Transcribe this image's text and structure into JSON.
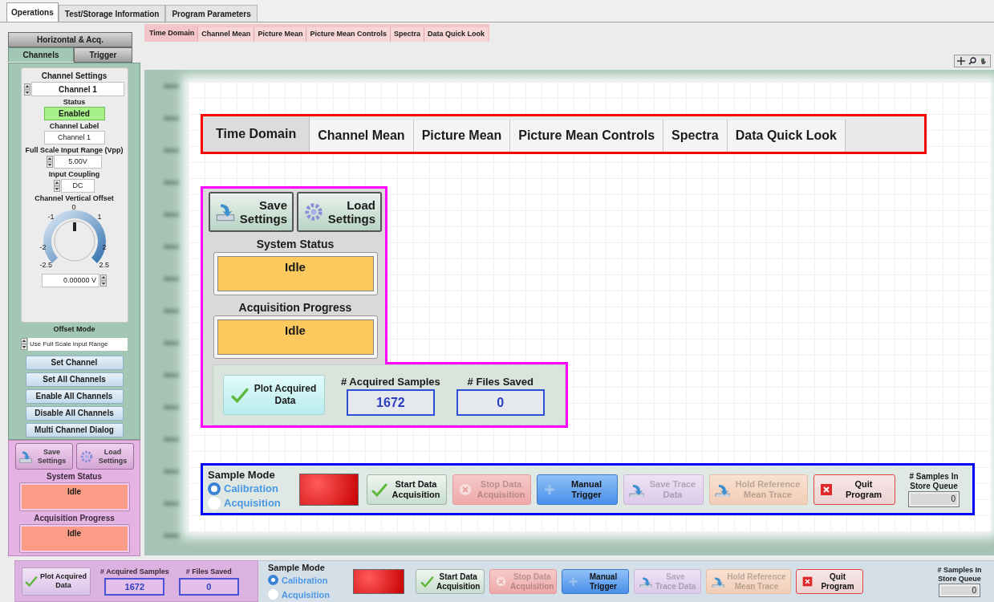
{
  "main_tabs": [
    {
      "label": "Operations",
      "selected": true
    },
    {
      "label": "Test/Storage Information",
      "selected": false
    },
    {
      "label": "Program Parameters",
      "selected": false
    }
  ],
  "side_tabs_upper": [
    {
      "label": "Horizontal & Acq.",
      "selected": false
    }
  ],
  "side_tabs_lower": [
    {
      "label": "Channels",
      "selected": true
    },
    {
      "label": "Trigger",
      "selected": false
    }
  ],
  "channel_settings": {
    "title": "Channel Settings",
    "channel": "Channel 1",
    "status_caption": "Status",
    "status": "Enabled",
    "enabled": true,
    "label_caption": "Channel Label",
    "label_value": "Channel 1",
    "range_caption": "Full Scale Input Range (Vpp)",
    "range_value": "5.00V",
    "coupling_caption": "Input Coupling",
    "coupling_value": "DC",
    "offset_caption": "Channel Vertical Offset",
    "dial": {
      "labels": [
        "0",
        "-1",
        "1",
        "-2",
        "2",
        "-2.5",
        "2.5"
      ]
    },
    "offset_value": "0.00000 V"
  },
  "offset_mode": {
    "caption": "Offset Mode",
    "value": "Use Full Scale Input Range"
  },
  "channel_buttons": [
    "Set Channel",
    "Set All Channels",
    "Enable All Channels",
    "Disable All Channels",
    "Multi Channel Dialog"
  ],
  "side_status": {
    "buttons": [
      {
        "kind": "save",
        "label": "Save Settings"
      },
      {
        "kind": "load",
        "label": "Load Settings"
      }
    ],
    "fields": [
      {
        "caption": "System Status",
        "value": "Idle"
      },
      {
        "caption": "Acquisition Progress",
        "value": "Idle"
      }
    ]
  },
  "sub_tabs": [
    {
      "label": "Time Domain",
      "selected": true
    },
    {
      "label": "Channel Mean",
      "selected": false
    },
    {
      "label": "Picture Mean",
      "selected": false
    },
    {
      "label": "Picture Mean Controls",
      "selected": false
    },
    {
      "label": "Spectra",
      "selected": false
    },
    {
      "label": "Data Quick Look",
      "selected": false
    }
  ],
  "callout": {
    "tabs": [
      {
        "label": "Time Domain",
        "selected": true
      },
      {
        "label": "Channel Mean",
        "selected": false
      },
      {
        "label": "Picture Mean",
        "selected": false
      },
      {
        "label": "Picture Mean Controls",
        "selected": false
      },
      {
        "label": "Spectra",
        "selected": false
      },
      {
        "label": "Data Quick Look",
        "selected": false
      }
    ],
    "status": {
      "buttons": [
        {
          "kind": "save",
          "label": "Save Settings"
        },
        {
          "kind": "load",
          "label": "Load Settings"
        }
      ],
      "fields": [
        {
          "caption": "System Status",
          "value": "Idle"
        },
        {
          "caption": "Acquisition Progress",
          "value": "Idle"
        }
      ]
    },
    "counters": {
      "plot_button": "Plot Acquired Data",
      "samples_caption": "# Acquired Samples",
      "samples": "1672",
      "files_caption": "# Files Saved",
      "files": "0"
    },
    "sample_mode": {
      "title": "Sample Mode",
      "options": [
        {
          "label": "Calibration",
          "selected": true
        },
        {
          "label": "Acquisition",
          "selected": false
        }
      ],
      "indicator_on": true,
      "buttons": [
        {
          "kind": "start",
          "label": "Start Data Acquisition",
          "disabled": false
        },
        {
          "kind": "stop",
          "label": "Stop Data Acquisition",
          "disabled": true
        },
        {
          "kind": "trigger",
          "label": "Manual Trigger",
          "disabled": false
        },
        {
          "kind": "save",
          "label": "Save Trace Data",
          "disabled": true
        },
        {
          "kind": "hold",
          "label": "Hold Reference Mean Trace",
          "disabled": true
        },
        {
          "kind": "quit",
          "label": "Quit Program",
          "disabled": false
        }
      ],
      "queue_caption": "# Samples In Store Queue",
      "queue_value": "0"
    }
  },
  "bottom": {
    "counters": {
      "plot_button": "Plot Acquired Data",
      "samples_caption": "# Acquired Samples",
      "samples": "1672",
      "files_caption": "# Files Saved",
      "files": "0"
    },
    "sample_mode": {
      "title": "Sample Mode",
      "options": [
        {
          "label": "Calibration",
          "selected": true
        },
        {
          "label": "Acquisition",
          "selected": false
        }
      ],
      "indicator_on": true,
      "buttons": [
        {
          "kind": "start",
          "label": "Start Data Acquisition",
          "disabled": false
        },
        {
          "kind": "stop",
          "label": "Stop Data Acquisition",
          "disabled": true
        },
        {
          "kind": "trigger",
          "label": "Manual Trigger",
          "disabled": false
        },
        {
          "kind": "save",
          "label": "Save Trace Data",
          "disabled": true
        },
        {
          "kind": "hold",
          "label": "Hold Reference Mean Trace",
          "disabled": true
        },
        {
          "kind": "quit",
          "label": "Quit Program",
          "disabled": false
        }
      ],
      "queue_caption": "# Samples In Store Queue",
      "queue_value": "0"
    }
  }
}
